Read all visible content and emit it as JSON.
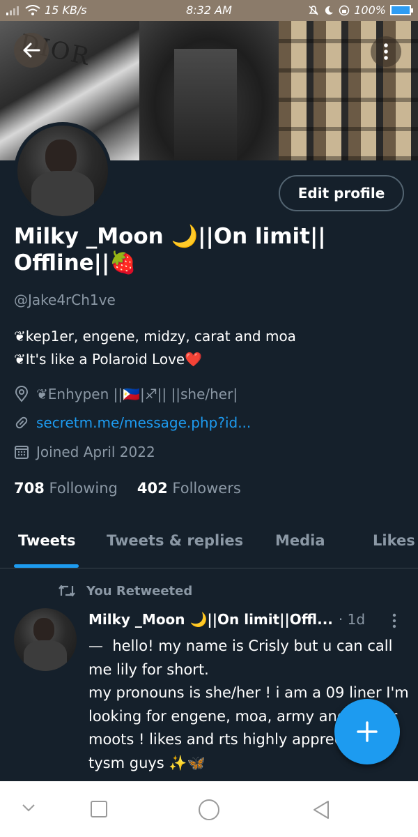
{
  "status_bar": {
    "network_speed": "15 KB/s",
    "time": "8:32 AM",
    "battery": "100%"
  },
  "header": {
    "banner_text": "DIOR",
    "back_icon": "arrow-left-icon",
    "more_icon": "more-vertical-icon"
  },
  "profile": {
    "edit_label": "Edit profile",
    "name": "Milky _Moon 🌙||On limit|| Offline||🍓",
    "handle": "@Jake4rCh1ve",
    "bio_lines": [
      "❦kep1er, engene, midzy, carat and moa",
      "❦It's like a Polaroid Love❤️"
    ],
    "location": "❦Enhypen ||🇵🇭|♐|| ||she/her|",
    "link": "secretm.me/message.php?id...",
    "joined": "Joined April 2022",
    "following_count": "708",
    "following_label": "Following",
    "followers_count": "402",
    "followers_label": "Followers"
  },
  "tabs": [
    {
      "label": "Tweets",
      "active": true
    },
    {
      "label": "Tweets & replies",
      "active": false
    },
    {
      "label": "Media",
      "active": false
    },
    {
      "label": "Likes",
      "active": false
    }
  ],
  "tweet": {
    "retweet_label": "You Retweeted",
    "author": "Milky _Moon 🌙||On limit||Offl...",
    "time": "· 1d",
    "text": "—  hello! my name is Crisly but u can call me lily for short.\nmy pronouns is she/her ! i am a 09 liner I'm looking for engene, moa, army and Kepler moots ! likes and rts highly appreciated tysm guys ✨🦋"
  },
  "fab_icon": "plus-icon",
  "nav_bar": {
    "icons": [
      "chevron-down-icon",
      "square-icon",
      "circle-icon",
      "triangle-back-icon"
    ]
  },
  "colors": {
    "background": "#15202b",
    "accent": "#1d9bf0",
    "secondary_text": "#8b98a5"
  }
}
